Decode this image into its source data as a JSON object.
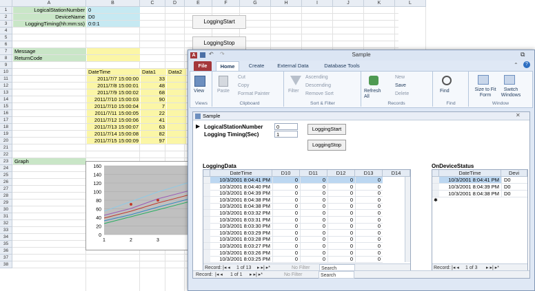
{
  "excel": {
    "columns": [
      "A",
      "B",
      "C",
      "D",
      "E",
      "F",
      "G",
      "H",
      "I",
      "J",
      "K",
      "L"
    ],
    "rows": [
      "1",
      "2",
      "3",
      "4",
      "5",
      "6",
      "7",
      "8",
      "9",
      "10",
      "11",
      "12",
      "13",
      "14",
      "15",
      "16",
      "17",
      "18",
      "19",
      "20",
      "21",
      "22",
      "23",
      "24",
      "25",
      "26",
      "27",
      "28",
      "29",
      "30",
      "31",
      "32",
      "33",
      "34",
      "35",
      "36",
      "37",
      "38"
    ],
    "labels": {
      "station": "LogicalStationNumber",
      "device": "DeviceName",
      "timing": "LoggingTiming(hh:mm:ss)",
      "message": "Message",
      "returncode": "ReturnCode",
      "graph": "Graph"
    },
    "values": {
      "station": "0",
      "device": "D0",
      "timing": "0:0:1"
    },
    "buttons": {
      "start": "LoggingStart",
      "stop": "LoggingStop"
    },
    "table_headers": [
      "DateTime",
      "Data1",
      "Data2"
    ],
    "table_rows": [
      {
        "dt": "2011/7/7 15:00:00",
        "v": "33"
      },
      {
        "dt": "2011/7/8 15:00:01",
        "v": "48"
      },
      {
        "dt": "2011/7/9 15:00:02",
        "v": "68"
      },
      {
        "dt": "2011/7/10 15:00:03",
        "v": "90"
      },
      {
        "dt": "2011/7/10 15:00:04",
        "v": "7"
      },
      {
        "dt": "2011/7/11 15:00:05",
        "v": "22"
      },
      {
        "dt": "2011/7/12 15:00:06",
        "v": "41"
      },
      {
        "dt": "2011/7/13 15:00:07",
        "v": "63"
      },
      {
        "dt": "2011/7/14 15:00:08",
        "v": "82"
      },
      {
        "dt": "2011/7/15 15:00:09",
        "v": "97"
      }
    ],
    "chart": {
      "y_ticks": [
        "160",
        "140",
        "120",
        "100",
        "80",
        "60",
        "40",
        "20",
        "0"
      ],
      "x_ticks": [
        "1",
        "2",
        "3"
      ]
    }
  },
  "access": {
    "title": "Sample",
    "ribbon_tabs": [
      "File",
      "Home",
      "Create",
      "External Data",
      "Database Tools"
    ],
    "ribbon": {
      "view": "View",
      "paste": "Paste",
      "cut": "Cut",
      "copy": "Copy",
      "format_painter": "Format Painter",
      "filter": "Filter",
      "ascending": "Ascending",
      "descending": "Descending",
      "remove_sort": "Remove Sort",
      "refresh": "Refresh All",
      "new": "New",
      "save": "Save",
      "delete": "Delete",
      "find": "Find",
      "size_to_fit": "Size to Fit Form",
      "switch_windows": "Switch Windows"
    },
    "groups": [
      "Views",
      "Clipboard",
      "Sort & Filter",
      "Records",
      "Find",
      "Window"
    ],
    "form_title": "Sample",
    "form": {
      "station_label": "LogicalStationNumber",
      "station_value": "0",
      "timing_label": "Logging Timing(Sec)",
      "timing_value": "1",
      "start_button": "LoggingStart",
      "stop_button": "LoggingStop"
    },
    "logging_title": "LoggingData",
    "logging_headers": [
      "DateTime",
      "D10",
      "D11",
      "D12",
      "D13",
      "D14"
    ],
    "logging_rows": [
      {
        "dt": "10/3/2001 8:04:41 PM",
        "v": "0"
      },
      {
        "dt": "10/3/2001 8:04:40 PM",
        "v": "0"
      },
      {
        "dt": "10/3/2001 8:04:39 PM",
        "v": "0"
      },
      {
        "dt": "10/3/2001 8:04:38 PM",
        "v": "0"
      },
      {
        "dt": "10/3/2001 8:04:38 PM",
        "v": "0"
      },
      {
        "dt": "10/3/2001 8:03:32 PM",
        "v": "0"
      },
      {
        "dt": "10/3/2001 8:03:31 PM",
        "v": "0"
      },
      {
        "dt": "10/3/2001 8:03:30 PM",
        "v": "0"
      },
      {
        "dt": "10/3/2001 8:03:29 PM",
        "v": "0"
      },
      {
        "dt": "10/3/2001 8:03:28 PM",
        "v": "0"
      },
      {
        "dt": "10/3/2001 8:03:27 PM",
        "v": "0"
      },
      {
        "dt": "10/3/2001 8:03:26 PM",
        "v": "0"
      },
      {
        "dt": "10/3/2001 8:03:25 PM",
        "v": "0"
      }
    ],
    "status_title": "OnDeviceStatus",
    "status_headers": [
      "DateTime",
      "Devi"
    ],
    "status_rows": [
      {
        "dt": "10/3/2001 8:04:41 PM",
        "d": "D0"
      },
      {
        "dt": "10/3/2001 8:04:39 PM",
        "d": "D0"
      },
      {
        "dt": "10/3/2001 8:04:38 PM",
        "d": "D0"
      }
    ],
    "nav_logging": {
      "record": "Record:",
      "pos": "1 of 13",
      "filter": "No Filter",
      "search": "Search"
    },
    "nav_status": {
      "record": "Record:",
      "pos": "1 of 3"
    },
    "nav_form": {
      "record": "Record:",
      "pos": "1 of 1",
      "filter": "No Filter",
      "search": "Search"
    }
  }
}
